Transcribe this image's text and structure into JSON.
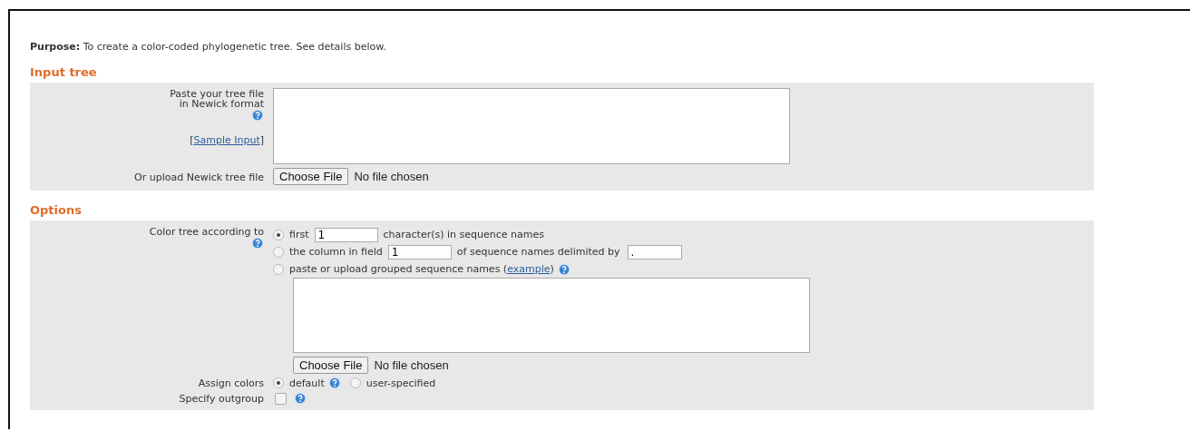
{
  "purpose": {
    "label": "Purpose:",
    "text": "To create a color-coded phylogenetic tree. See details below."
  },
  "input_tree": {
    "heading": "Input tree",
    "paste_label_lines": [
      "Paste your tree file",
      "in Newick format"
    ],
    "sample": {
      "open": "[",
      "link": "Sample Input",
      "close": "]"
    },
    "upload": {
      "label": "Or upload Newick tree file",
      "button": "Choose File",
      "status": "No file chosen"
    }
  },
  "options": {
    "heading": "Options",
    "color_by": {
      "label": "Color tree according to",
      "choices": [
        {
          "kind": "first",
          "selected": true,
          "before": "first",
          "value": "1",
          "after": "character(s) in sequence names"
        },
        {
          "kind": "column",
          "selected": false,
          "before": "the column in field",
          "value": "1",
          "after": "of sequence names delimited by",
          "delimiter": "."
        },
        {
          "kind": "grouped",
          "selected": false,
          "before": "paste or upload grouped sequence names (",
          "link": "example",
          "after": ")"
        }
      ],
      "upload": {
        "button": "Choose File",
        "status": "No file chosen"
      }
    },
    "assign_colors": {
      "label": "Assign colors",
      "choices": [
        {
          "label": "default",
          "selected": true
        },
        {
          "label": "user-specified",
          "selected": false
        }
      ]
    },
    "outgroup": {
      "label": "Specify outgroup",
      "checked": false
    }
  }
}
